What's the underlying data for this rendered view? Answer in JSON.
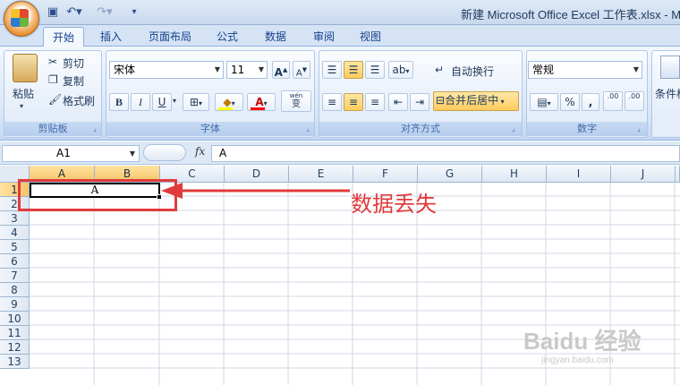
{
  "window": {
    "title": "新建 Microsoft Office Excel 工作表.xlsx - M"
  },
  "ribbon_tabs": [
    "开始",
    "插入",
    "页面布局",
    "公式",
    "数据",
    "审阅",
    "视图"
  ],
  "clipboard": {
    "paste": "粘贴",
    "cut": "剪切",
    "copy": "复制",
    "format_painter": "格式刷",
    "group": "剪贴板"
  },
  "font": {
    "name": "宋体",
    "size": "11",
    "bold": "B",
    "italic": "I",
    "underline": "U",
    "color_glyph": "A",
    "phonetic": "wén",
    "phonetic_char": "变",
    "grow": "A",
    "shrink": "A",
    "group": "字体"
  },
  "alignment": {
    "wrap_text": "自动换行",
    "merge_center": "合并后居中",
    "group": "对齐方式"
  },
  "number": {
    "format": "常规",
    "percent": "%",
    "comma": ",",
    "inc_decimal": ".00",
    "dec_decimal": ".00",
    "group": "数字"
  },
  "styles": {
    "conditional": "条件格"
  },
  "formula_bar": {
    "name_box": "A1",
    "fx": "fx",
    "content": "A"
  },
  "sheet": {
    "columns": [
      "A",
      "B",
      "C",
      "D",
      "E",
      "F",
      "G",
      "H",
      "I",
      "J"
    ],
    "rows": [
      "1",
      "2",
      "3",
      "4",
      "5",
      "6",
      "7",
      "8",
      "9",
      "10",
      "11",
      "12",
      "13"
    ],
    "selected_cell_value": "A"
  },
  "annotation": {
    "text": "数据丢失",
    "color": "#e03b3b"
  },
  "watermark": {
    "logo": "Baidu 经验",
    "url": "jingyan.baidu.com"
  },
  "colors": {
    "ribbon_bg": "#d9e6f6",
    "header_selected": "#f7c467",
    "accent": "#15428b"
  }
}
